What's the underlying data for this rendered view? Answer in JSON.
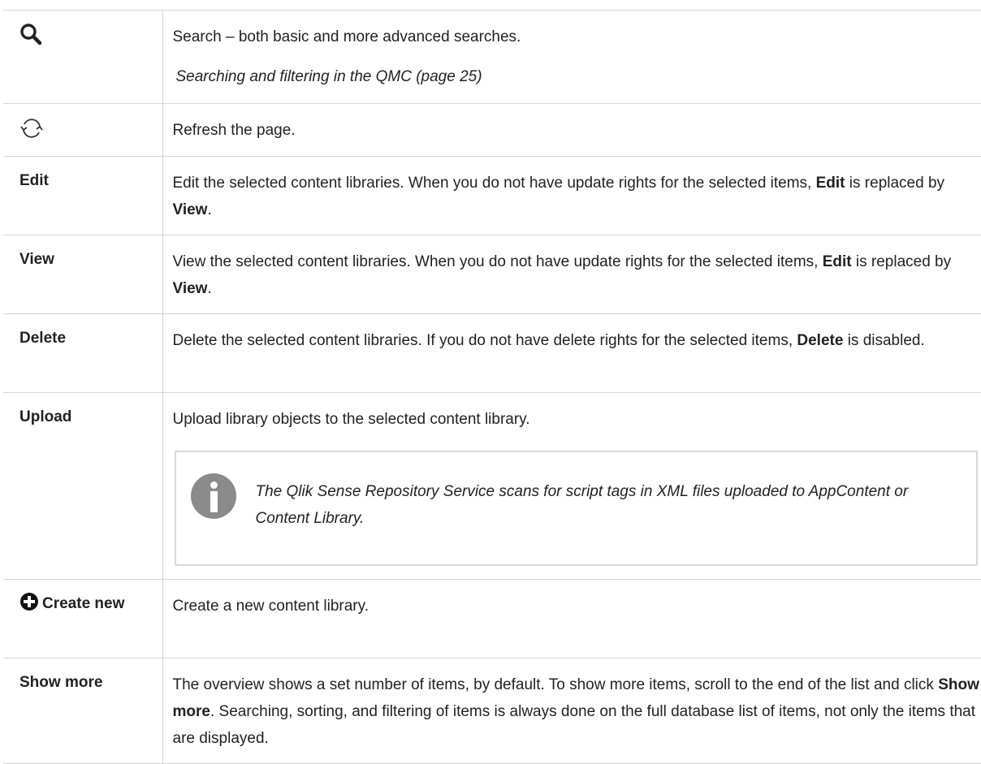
{
  "rows": [
    {
      "label_icon": "search-icon",
      "desc": "Search – both basic and more advanced searches.",
      "link": "Searching and filtering in the QMC (page 25)"
    },
    {
      "label_icon": "refresh-icon",
      "desc": "Refresh the page."
    },
    {
      "label": "Edit",
      "desc_a": "Edit the selected content libraries. When you do not have update rights for the selected items, ",
      "kw1": "Edit",
      "desc_b": " is replaced by ",
      "kw2": "View",
      "desc_c": "."
    },
    {
      "label": "View",
      "desc_a": "View the selected content libraries. When you do not have update rights for the selected items, ",
      "kw1": "Edit",
      "desc_b": " is replaced by ",
      "kw2": "View",
      "desc_c": "."
    },
    {
      "label": "Delete",
      "desc_a": "Delete the selected content libraries. If you do not have delete rights for the selected items, ",
      "kw1": "Delete",
      "desc_b": " is disabled."
    },
    {
      "label": "Upload",
      "desc": "Upload library objects to the selected content library.",
      "note_icon": "info-icon",
      "note": "The Qlik Sense Repository Service scans for script tags in XML files uploaded to AppContent or Content Library."
    },
    {
      "label_icon": "plus-circle-icon",
      "label": "Create new",
      "desc": "Create a new content library."
    },
    {
      "label": "Show more",
      "desc_a": "The overview shows a set number of items, by default. To show more items, scroll to the end of the list and click ",
      "kw1": "Show more",
      "desc_b": ". Searching, sorting, and filtering of items is always done on the full database list of items, not only the items that are displayed."
    }
  ]
}
